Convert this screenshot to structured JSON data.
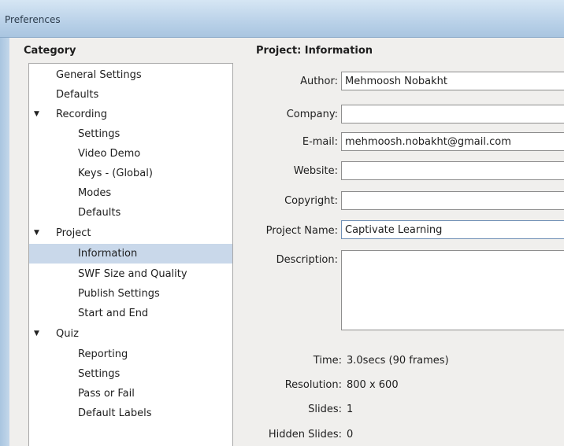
{
  "window": {
    "title": "Preferences"
  },
  "category": {
    "heading": "Category",
    "items": [
      {
        "label": "General Settings",
        "level": 1,
        "arrow": ""
      },
      {
        "label": "Defaults",
        "level": 1,
        "arrow": ""
      },
      {
        "label": "Recording",
        "level": 1,
        "arrow": "▼"
      },
      {
        "label": "Settings",
        "level": 2,
        "arrow": ""
      },
      {
        "label": "Video Demo",
        "level": 2,
        "arrow": ""
      },
      {
        "label": "Keys - (Global)",
        "level": 2,
        "arrow": ""
      },
      {
        "label": "Modes",
        "level": 2,
        "arrow": ""
      },
      {
        "label": "Defaults",
        "level": 2,
        "arrow": ""
      },
      {
        "label": "Project",
        "level": 1,
        "arrow": "▼"
      },
      {
        "label": "Information",
        "level": 2,
        "arrow": "",
        "selected": true
      },
      {
        "label": "SWF Size and Quality",
        "level": 2,
        "arrow": ""
      },
      {
        "label": "Publish Settings",
        "level": 2,
        "arrow": ""
      },
      {
        "label": "Start and End",
        "level": 2,
        "arrow": ""
      },
      {
        "label": "Quiz",
        "level": 1,
        "arrow": "▼"
      },
      {
        "label": "Reporting",
        "level": 2,
        "arrow": ""
      },
      {
        "label": "Settings",
        "level": 2,
        "arrow": ""
      },
      {
        "label": "Pass or Fail",
        "level": 2,
        "arrow": ""
      },
      {
        "label": "Default Labels",
        "level": 2,
        "arrow": ""
      }
    ]
  },
  "project": {
    "heading": "Project: Information",
    "author_label": "Author:",
    "author_value": "Mehmoosh Nobakht",
    "company_label": "Company:",
    "company_value": "",
    "email_label": "E-mail:",
    "email_value": "mehmoosh.nobakht@gmail.com",
    "website_label": "Website:",
    "website_value": "",
    "copyright_label": "Copyright:",
    "copyright_value": "",
    "project_name_label": "Project Name:",
    "project_name_value": "Captivate Learning",
    "description_label": "Description:",
    "description_value": "",
    "time_label": "Time:",
    "time_value": "3.0secs (90 frames)",
    "resolution_label": "Resolution:",
    "resolution_value": "800 x 600",
    "slides_label": "Slides:",
    "slides_value": "1",
    "hidden_slides_label": "Hidden Slides:",
    "hidden_slides_value": "0"
  },
  "colors": {
    "selection": "#c9d8ea",
    "titlebar": "#b9d1e8"
  }
}
